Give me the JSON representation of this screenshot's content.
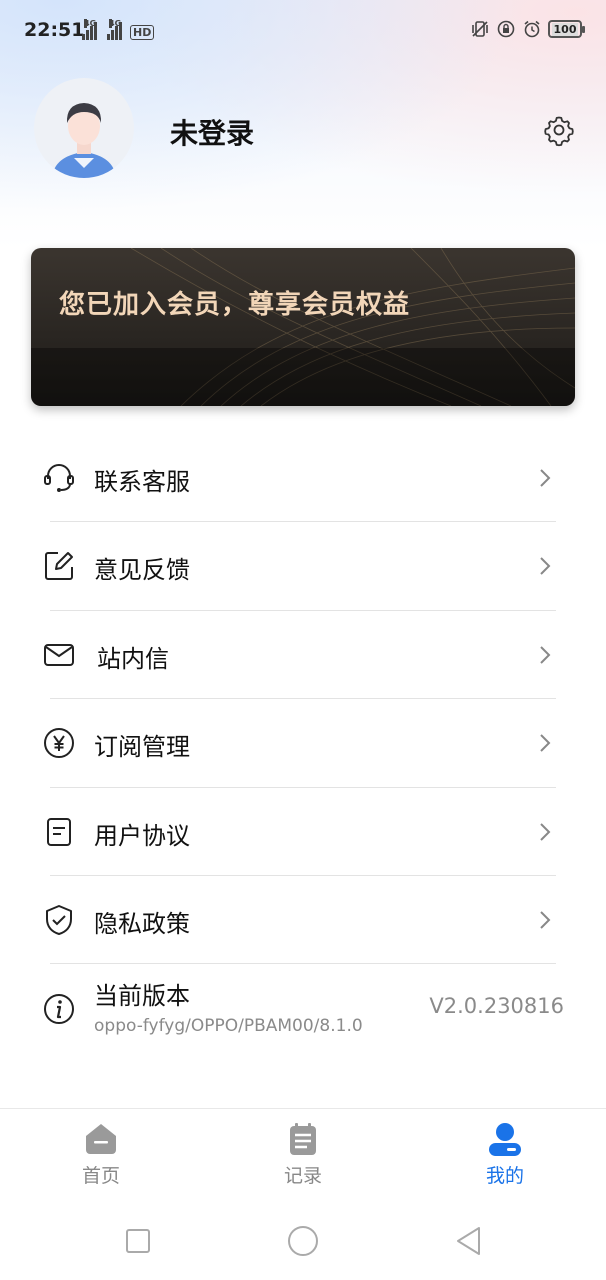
{
  "status_bar": {
    "time": "22:51",
    "network_tags": [
      "4G",
      "4G"
    ],
    "hd": "HD",
    "battery": "100"
  },
  "profile": {
    "name": "未登录"
  },
  "member_banner": {
    "text": "您已加入会员，尊享会员权益"
  },
  "menu": {
    "items": [
      {
        "label": "联系客服",
        "icon": "headset-icon"
      },
      {
        "label": "意见反馈",
        "icon": "edit-icon"
      },
      {
        "label": "站内信",
        "icon": "mail-icon"
      },
      {
        "label": "订阅管理",
        "icon": "yen-icon"
      },
      {
        "label": "用户协议",
        "icon": "document-icon"
      },
      {
        "label": "隐私政策",
        "icon": "shield-check-icon"
      }
    ],
    "version": {
      "label": "当前版本",
      "subtitle": "oppo-fyfyg/OPPO/PBAM00/8.1.0",
      "value": "V2.0.230816",
      "icon": "info-icon"
    }
  },
  "bottom_nav": {
    "items": [
      {
        "label": "首页",
        "icon": "home-icon",
        "active": false
      },
      {
        "label": "记录",
        "icon": "clipboard-icon",
        "active": false
      },
      {
        "label": "我的",
        "icon": "profile-icon",
        "active": true
      }
    ]
  },
  "colors": {
    "accent": "#1a73e8",
    "member_text": "#f2d6b8",
    "secondary_text": "#8a8a8a"
  }
}
